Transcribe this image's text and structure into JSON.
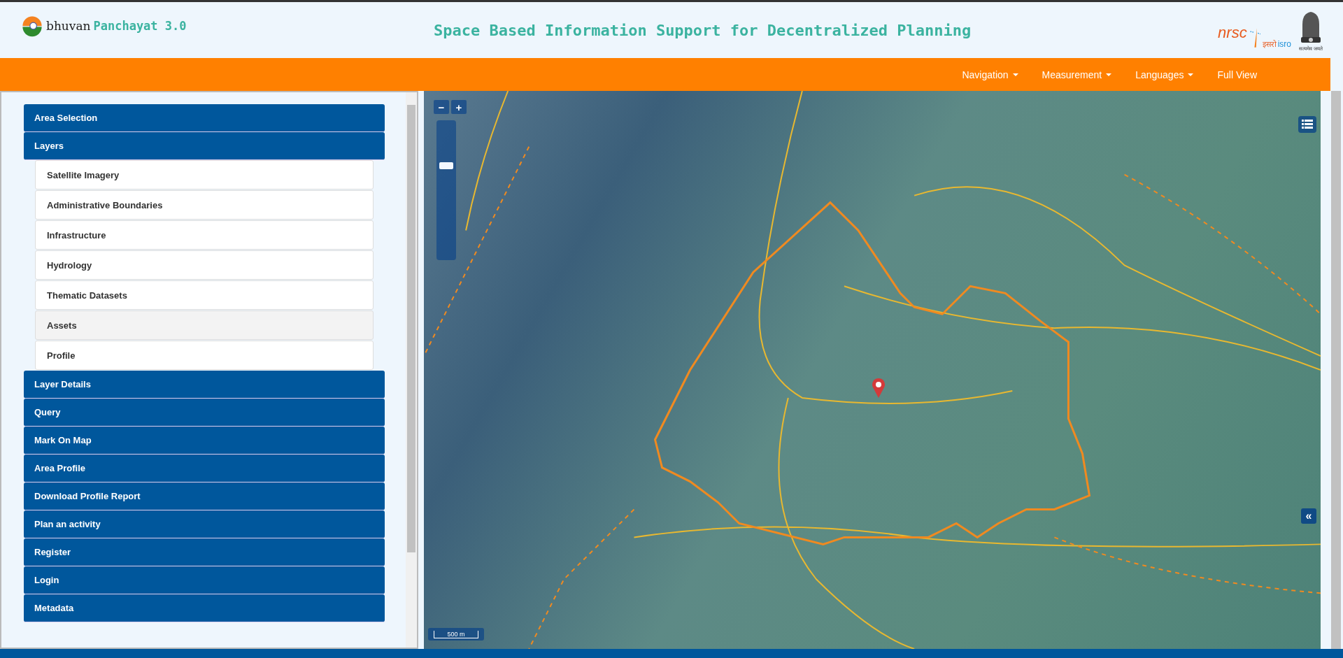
{
  "header": {
    "logo_text": "bhuvan",
    "app_name": "Panchayat 3.0",
    "title": "Space Based Information Support for Decentralized Planning",
    "org_logo": {
      "name": "nrsc",
      "hindi": "इसरो",
      "latin": "isro"
    },
    "emblem_motto": "सत्यमेव जयते"
  },
  "nav": [
    {
      "label": "Navigation",
      "dropdown": true
    },
    {
      "label": "Measurement",
      "dropdown": true
    },
    {
      "label": "Languages",
      "dropdown": true
    },
    {
      "label": "Full View",
      "dropdown": false
    }
  ],
  "sidebar": {
    "sections": [
      {
        "label": "Area Selection"
      },
      {
        "label": "Layers",
        "children": [
          {
            "label": "Satellite Imagery",
            "selected": false
          },
          {
            "label": "Administrative Boundaries",
            "selected": false
          },
          {
            "label": "Infrastructure",
            "selected": false
          },
          {
            "label": "Hydrology",
            "selected": false
          },
          {
            "label": "Thematic Datasets",
            "selected": false
          },
          {
            "label": "Assets",
            "selected": true
          },
          {
            "label": "Profile",
            "selected": false
          }
        ]
      },
      {
        "label": "Layer Details"
      },
      {
        "label": "Query"
      },
      {
        "label": "Mark On Map"
      },
      {
        "label": "Area Profile"
      },
      {
        "label": "Download Profile Report"
      },
      {
        "label": "Plan an activity"
      },
      {
        "label": "Register"
      },
      {
        "label": "Login"
      },
      {
        "label": "Metadata"
      }
    ]
  },
  "map": {
    "zoom_out": "−",
    "zoom_in": "+",
    "zoom_slider": {
      "level": 0.7
    },
    "collapse": "«",
    "scale": "500 m"
  }
}
